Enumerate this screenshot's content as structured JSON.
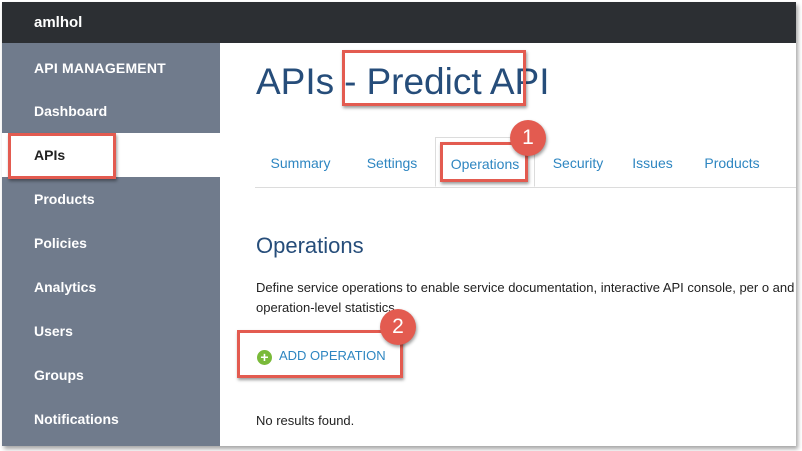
{
  "topbar": {
    "user": "amlhol"
  },
  "sidebar": {
    "header": "API MANAGEMENT",
    "items": [
      {
        "label": "Dashboard"
      },
      {
        "label": "APIs"
      },
      {
        "label": "Products"
      },
      {
        "label": "Policies"
      },
      {
        "label": "Analytics"
      },
      {
        "label": "Users"
      },
      {
        "label": "Groups"
      },
      {
        "label": "Notifications"
      }
    ],
    "active_item": "APIs"
  },
  "page": {
    "title_prefix": "APIs",
    "title_sep": "-",
    "title_name": "Predict API"
  },
  "tabs": {
    "items": [
      {
        "label": "Summary"
      },
      {
        "label": "Settings"
      },
      {
        "label": "Operations"
      },
      {
        "label": "Security"
      },
      {
        "label": "Issues"
      },
      {
        "label": "Products"
      }
    ],
    "active": "Operations"
  },
  "operations": {
    "heading": "Operations",
    "description": "Define service operations to enable service documentation, interactive API console, per o and operation-level statistics.",
    "add_label": "ADD OPERATION",
    "add_icon": "plus-circle-icon",
    "empty_text": "No results found."
  },
  "annotations": {
    "callout_1": "1",
    "callout_2": "2",
    "color": "#e35b50"
  },
  "colors": {
    "topbar": "#2c2f33",
    "sidebar": "#707b8c",
    "title": "#264d7a",
    "link": "#2e86c1",
    "add_icon": "#7aba3a"
  }
}
